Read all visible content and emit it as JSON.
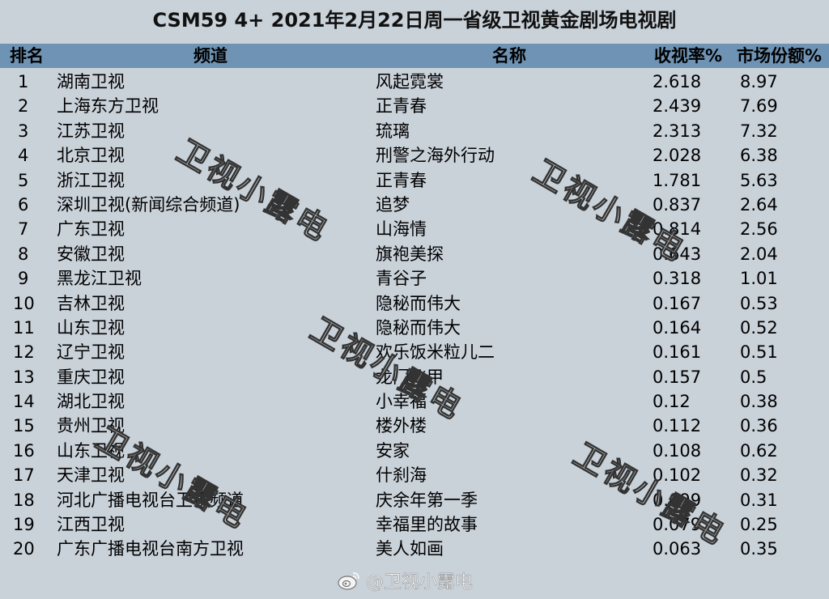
{
  "title": "CSM59 4+ 2021年2月22日周一省级卫视黄金剧场电视剧",
  "headers": {
    "rank": "排名",
    "channel": "频道",
    "show": "名称",
    "rating": "收视率%",
    "share": "市场份额%"
  },
  "rows": [
    {
      "rank": "1",
      "channel": "湖南卫视",
      "show": "风起霓裳",
      "rating": "2.618",
      "share": "8.97"
    },
    {
      "rank": "2",
      "channel": "上海东方卫视",
      "show": "正青春",
      "rating": "2.439",
      "share": "7.69"
    },
    {
      "rank": "3",
      "channel": "江苏卫视",
      "show": "琉璃",
      "rating": "2.313",
      "share": "7.32"
    },
    {
      "rank": "4",
      "channel": "北京卫视",
      "show": "刑警之海外行动",
      "rating": "2.028",
      "share": "6.38"
    },
    {
      "rank": "5",
      "channel": "浙江卫视",
      "show": "正青春",
      "rating": "1.781",
      "share": "5.63"
    },
    {
      "rank": "6",
      "channel": "深圳卫视(新闻综合频道)",
      "show": "追梦",
      "rating": "0.837",
      "share": "2.64"
    },
    {
      "rank": "7",
      "channel": "广东卫视",
      "show": "山海情",
      "rating": "0.814",
      "share": "2.56"
    },
    {
      "rank": "8",
      "channel": "安徽卫视",
      "show": "旗袍美探",
      "rating": "0.643",
      "share": "2.04"
    },
    {
      "rank": "9",
      "channel": "黑龙江卫视",
      "show": "青谷子",
      "rating": "0.318",
      "share": "1.01"
    },
    {
      "rank": "10",
      "channel": "吉林卫视",
      "show": "隐秘而伟大",
      "rating": "0.167",
      "share": "0.53"
    },
    {
      "rank": "11",
      "channel": "山东卫视",
      "show": "隐秘而伟大",
      "rating": "0.164",
      "share": "0.52"
    },
    {
      "rank": "12",
      "channel": "辽宁卫视",
      "show": "欢乐饭米粒儿二",
      "rating": "0.161",
      "share": "0.51"
    },
    {
      "rank": "13",
      "channel": "重庆卫视",
      "show": "龙门飞甲",
      "rating": "0.157",
      "share": "0.5"
    },
    {
      "rank": "14",
      "channel": "湖北卫视",
      "show": "小幸福",
      "rating": "0.12",
      "share": "0.38"
    },
    {
      "rank": "15",
      "channel": "贵州卫视",
      "show": "楼外楼",
      "rating": "0.112",
      "share": "0.36"
    },
    {
      "rank": "16",
      "channel": "山东卫视",
      "show": "安家",
      "rating": "0.108",
      "share": "0.62"
    },
    {
      "rank": "17",
      "channel": "天津卫视",
      "show": "什刹海",
      "rating": "0.102",
      "share": "0.32"
    },
    {
      "rank": "18",
      "channel": "河北广播电视台卫视频道",
      "show": "庆余年第一季",
      "rating": "0.099",
      "share": "0.31"
    },
    {
      "rank": "19",
      "channel": "江西卫视",
      "show": "幸福里的故事",
      "rating": "0.079",
      "share": "0.25"
    },
    {
      "rank": "20",
      "channel": "广东广播电视台南方卫视",
      "show": "美人如画",
      "rating": "0.063",
      "share": "0.35"
    }
  ],
  "watermark": "卫视小露电",
  "weibo_handle": "@卫视小露电",
  "icons": {
    "weibo": "weibo-logo-icon"
  },
  "colors": {
    "background": "#c9d1d9",
    "header": "#6f93b4"
  }
}
